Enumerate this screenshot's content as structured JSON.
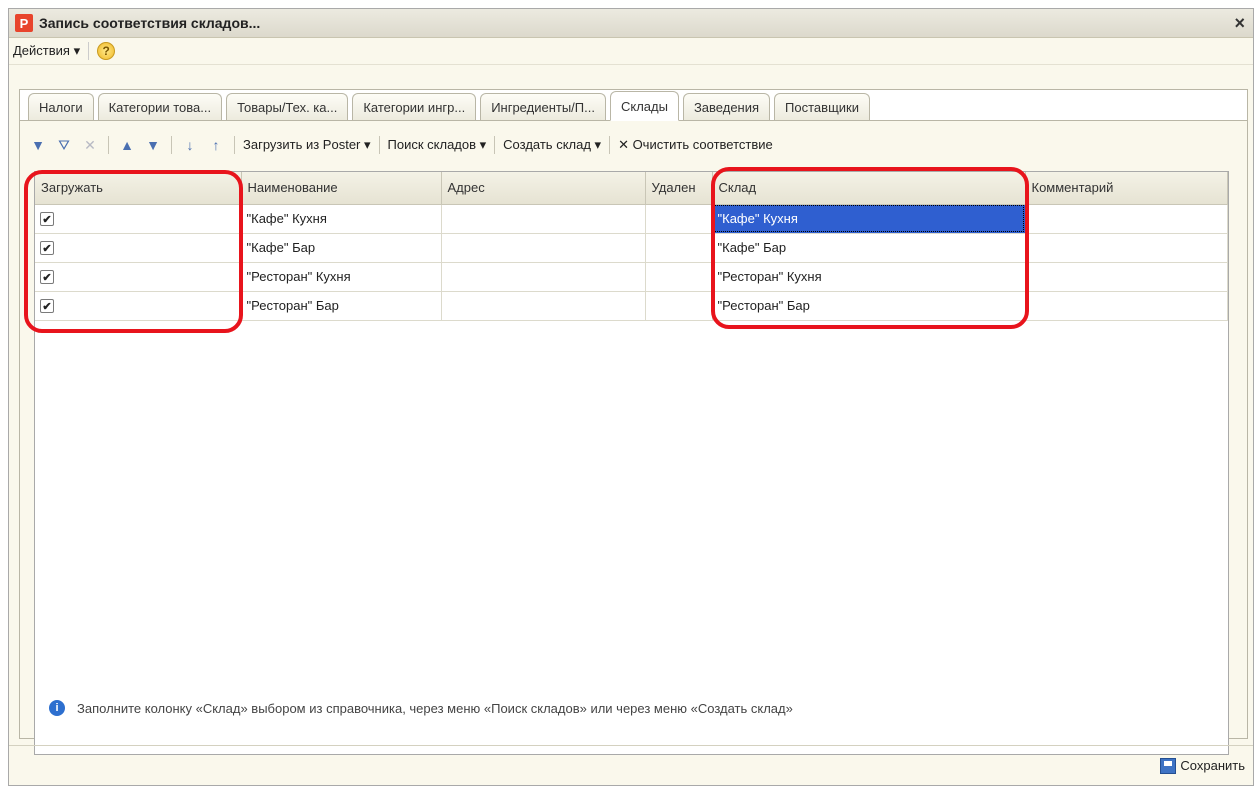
{
  "window": {
    "title": "Запись соответствия складов...",
    "close": "×"
  },
  "menu": {
    "actions": "Действия ▾",
    "help": "?"
  },
  "tabs": [
    {
      "label": "Налоги",
      "active": false
    },
    {
      "label": "Категории това...",
      "active": false
    },
    {
      "label": "Товары/Тех. ка...",
      "active": false
    },
    {
      "label": "Категории ингр...",
      "active": false
    },
    {
      "label": "Ингредиенты/П...",
      "active": false
    },
    {
      "label": "Склады",
      "active": true
    },
    {
      "label": "Заведения",
      "active": false
    },
    {
      "label": "Поставщики",
      "active": false
    }
  ],
  "toolbar": {
    "load_poster": "Загрузить из Poster ▾",
    "find_stores": "Поиск складов ▾",
    "create_store": "Создать склад ▾",
    "clear_match": "✕ Очистить соответствие"
  },
  "table": {
    "columns": [
      "Загружать",
      "Наименование",
      "Адрес",
      "Удален",
      "Склад",
      "Комментарий"
    ],
    "rows": [
      {
        "load": true,
        "name": "\"Кафе\" Кухня",
        "address": "",
        "deleted": "",
        "store": "\"Кафе\" Кухня",
        "comment": ""
      },
      {
        "load": true,
        "name": "\"Кафе\" Бар",
        "address": "",
        "deleted": "",
        "store": "\"Кафе\" Бар",
        "comment": ""
      },
      {
        "load": true,
        "name": "\"Ресторан\" Кухня",
        "address": "",
        "deleted": "",
        "store": "\"Ресторан\" Кухня",
        "comment": ""
      },
      {
        "load": true,
        "name": "\"Ресторан\" Бар",
        "address": "",
        "deleted": "",
        "store": "\"Ресторан\" Бар",
        "comment": ""
      }
    ],
    "check_mark": "✔"
  },
  "info": "Заполните колонку «Склад» выбором из справочника, через меню «Поиск складов» или через меню «Создать склад»",
  "footer": {
    "save": "Сохранить"
  },
  "colors": {
    "highlight": "#e8141c",
    "selection": "#2f5fd0"
  }
}
